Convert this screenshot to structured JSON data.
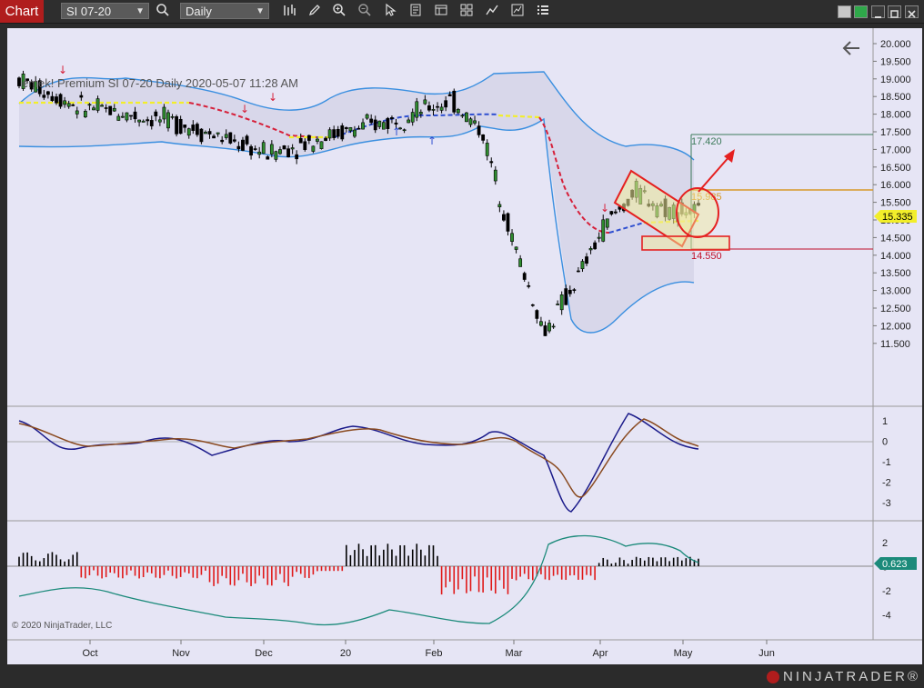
{
  "toolbar": {
    "chart_tab": "Chart",
    "instrument": "SI 07-20",
    "interval": "Daily"
  },
  "chart": {
    "title_line": "emek! Premium  SI 07-20  Daily  2020-05-07 11:28 AM",
    "copyright": "© 2020 NinjaTrader, LLC",
    "price_axis": [
      "20.000",
      "19.500",
      "19.000",
      "18.500",
      "18.000",
      "17.500",
      "17.000",
      "16.500",
      "16.000",
      "15.500",
      "15.000",
      "14.500",
      "14.000",
      "13.500",
      "13.000",
      "12.500",
      "12.000",
      "11.500"
    ],
    "osc_axis": [
      "1",
      "0",
      "-1",
      "-2",
      "-3"
    ],
    "hist_axis": [
      "2",
      "0",
      "-2",
      "-4"
    ],
    "x_axis": [
      "Oct",
      "Nov",
      "Dec",
      "20",
      "Feb",
      "Mar",
      "Apr",
      "May",
      "Jun"
    ],
    "levels": {
      "target": "17.420",
      "mid": "15.985",
      "stop": "14.550",
      "last": "15.335",
      "hist_last": "0.623"
    }
  },
  "brand": {
    "name": "NINJATRADER",
    "mark": "®"
  },
  "colors": {
    "background": "#e6e5f5",
    "bull": "#2e8b2e",
    "bear": "#000000",
    "band": "#3a8fe0",
    "target_line": "#3c7a5a",
    "mid_line": "#d79a2a",
    "stop_line": "#c0102a",
    "last_tag": "#f2ee2a",
    "hist_tag": "#1b8a7a",
    "accent": "#b01d1d"
  },
  "chart_data": {
    "type": "line",
    "title": "",
    "xlabel": "",
    "ylabel": "",
    "ylim": [
      11.5,
      20.0
    ],
    "series": [
      {
        "values": [
          19.1,
          18.7,
          18.3,
          18.2,
          18.0,
          17.9,
          17.6,
          17.3,
          17.0,
          17.2,
          17.5,
          17.7,
          17.9,
          18.2,
          18.5,
          17.6,
          14.5,
          11.9,
          13.3,
          15.0,
          15.9,
          15.4,
          15.3
        ]
      }
    ]
  }
}
